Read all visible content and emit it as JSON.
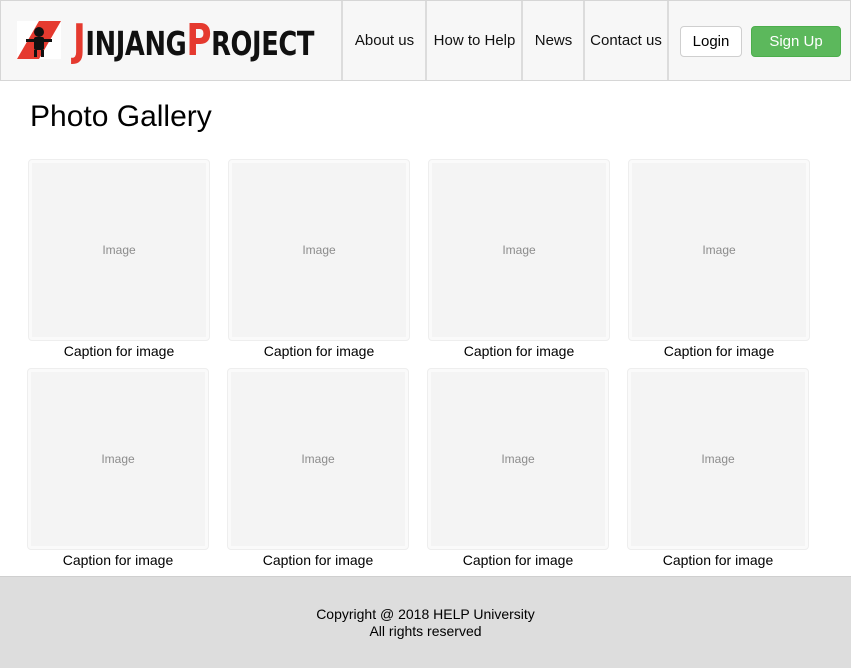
{
  "brand": {
    "name_parts": [
      {
        "text": "J",
        "style": "big"
      },
      {
        "text": "INJANG",
        "style": "sm"
      },
      {
        "text": "P",
        "style": "big"
      },
      {
        "text": "ROJECT",
        "style": "sm"
      }
    ],
    "accent_color": "#e53a2f"
  },
  "nav": {
    "items": [
      {
        "label": "About us"
      },
      {
        "label": "How to Help"
      },
      {
        "label": "News"
      },
      {
        "label": "Contact us"
      }
    ],
    "login_label": "Login",
    "signup_label": "Sign Up",
    "signup_color": "#5cb85c"
  },
  "main": {
    "title": "Photo Gallery",
    "gallery": [
      {
        "placeholder": "Image",
        "caption": "Caption for image"
      },
      {
        "placeholder": "Image",
        "caption": "Caption for image"
      },
      {
        "placeholder": "Image",
        "caption": "Caption for image"
      },
      {
        "placeholder": "Image",
        "caption": "Caption for image"
      },
      {
        "placeholder": "Image",
        "caption": "Caption for image"
      },
      {
        "placeholder": "Image",
        "caption": "Caption for image"
      },
      {
        "placeholder": "Image",
        "caption": "Caption for image"
      },
      {
        "placeholder": "Image",
        "caption": "Caption for image"
      }
    ]
  },
  "footer": {
    "copyright": "Copyright @ 2018 HELP University",
    "rights": "All rights reserved"
  }
}
